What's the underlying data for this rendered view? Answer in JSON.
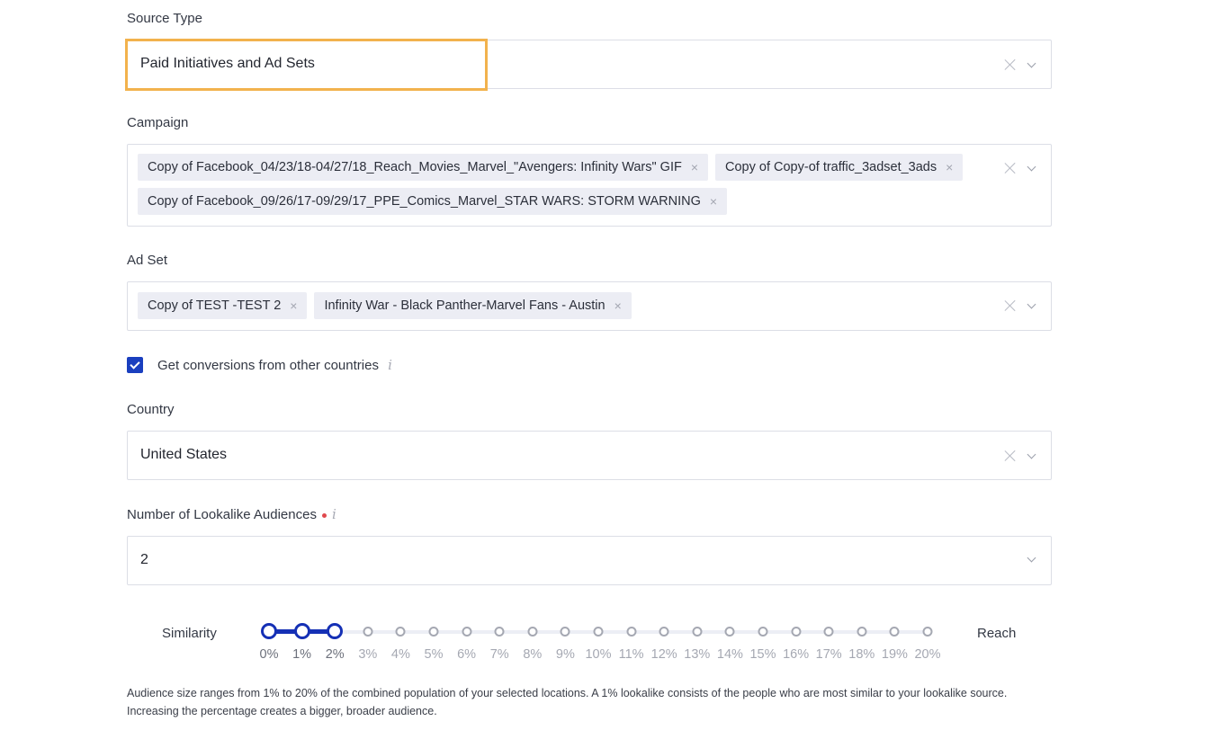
{
  "source_type": {
    "label": "Source Type",
    "value": "Paid Initiatives and Ad Sets"
  },
  "campaign": {
    "label": "Campaign",
    "tags": [
      "Copy of Facebook_04/23/18-04/27/18_Reach_Movies_Marvel_\"Avengers: Infinity Wars\" GIF",
      "Copy of Copy-of traffic_3adset_3ads",
      "Copy of Facebook_09/26/17-09/29/17_PPE_Comics_Marvel_STAR WARS: STORM WARNING"
    ]
  },
  "ad_set": {
    "label": "Ad Set",
    "tags": [
      "Copy of TEST -TEST 2",
      "Infinity War - Black Panther-Marvel Fans - Austin"
    ]
  },
  "conversions_checkbox": {
    "label": "Get conversions from other countries",
    "checked": true,
    "info_icon": "i"
  },
  "country": {
    "label": "Country",
    "value": "United States"
  },
  "lookalike_count": {
    "label": "Number of Lookalike Audiences",
    "required": true,
    "info_icon": "i",
    "value": "2"
  },
  "slider": {
    "left_label": "Similarity",
    "right_label": "Reach",
    "selected_range": [
      "0%",
      "2%"
    ],
    "stops": [
      "0%",
      "1%",
      "2%",
      "3%",
      "4%",
      "5%",
      "6%",
      "7%",
      "8%",
      "9%",
      "10%",
      "11%",
      "12%",
      "13%",
      "14%",
      "15%",
      "16%",
      "17%",
      "18%",
      "19%",
      "20%"
    ],
    "active_count": 3,
    "accent_color": "#1530b5"
  },
  "help_text": "Audience size ranges from 1% to 20% of the combined population of your selected locations. A 1% lookalike consists of the people who are most similar to your lookalike source. Increasing the percentage creates a bigger, broader audience.",
  "remove_glyph": "×",
  "highlight_color": "#f2b24d"
}
